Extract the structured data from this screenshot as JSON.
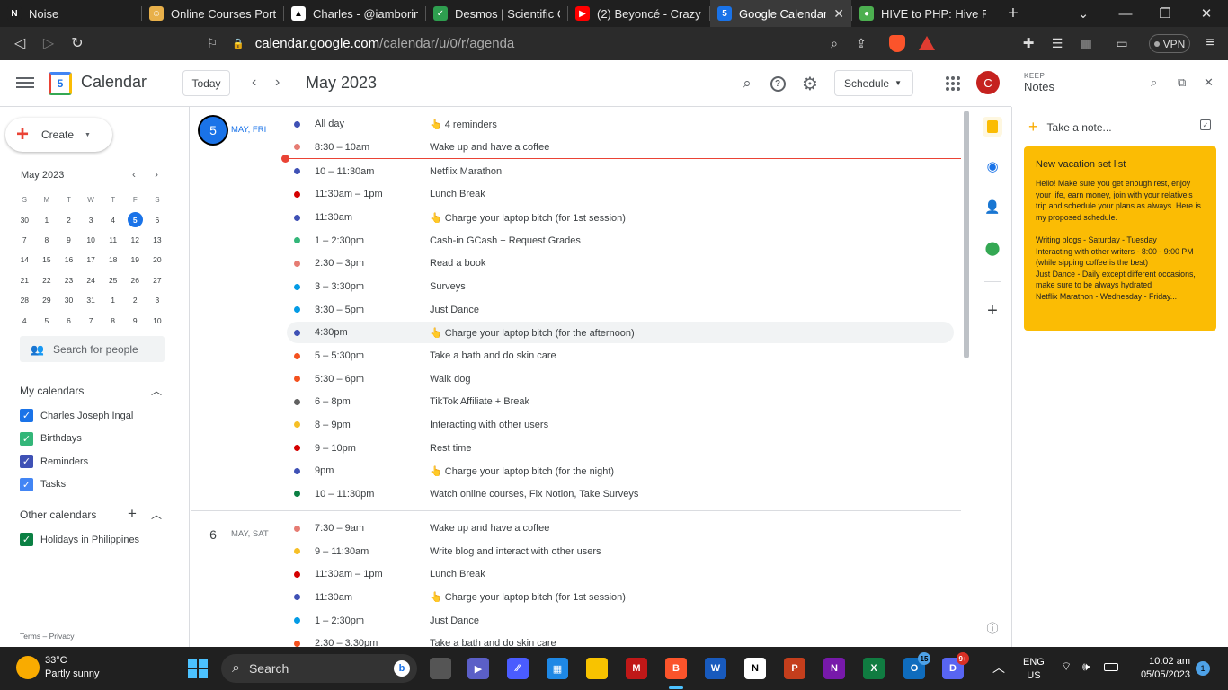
{
  "browser": {
    "tabs": [
      {
        "label": "Noise",
        "favicon_color": "#1f1f1f",
        "favicon_text": "N",
        "active": false
      },
      {
        "label": "Online Courses Portal",
        "favicon_color": "#e8b04a",
        "favicon_text": "☺",
        "active": false
      },
      {
        "label": "Charles - @iamboring",
        "favicon_color": "#ffffff",
        "favicon_text": "▲",
        "active": false
      },
      {
        "label": "Desmos | Scientific Cal",
        "favicon_color": "#2e9e4f",
        "favicon_text": "✓",
        "active": false
      },
      {
        "label": "(2) Beyoncé - Crazy",
        "favicon_color": "#ff0000",
        "favicon_text": "▶",
        "active": false
      },
      {
        "label": "Google Calendar -",
        "favicon_color": "#1a73e8",
        "favicon_text": "5",
        "active": true
      },
      {
        "label": "HIVE to PHP: Hive Pric",
        "favicon_color": "#4caf50",
        "favicon_text": "●",
        "active": false
      }
    ],
    "close_glyph": "✕",
    "new_tab_glyph": "+",
    "url_host": "calendar.google.com",
    "url_path": "/calendar/u/0/r/agenda",
    "vpn_label": "VPN"
  },
  "header": {
    "app_name": "Calendar",
    "logo_day": "5",
    "today_label": "Today",
    "month_title": "May 2023",
    "view_label": "Schedule",
    "avatar_letter": "C"
  },
  "sidebar": {
    "create_label": "Create",
    "mini_calendar": {
      "title": "May 2023",
      "weekdays": [
        "S",
        "M",
        "T",
        "W",
        "T",
        "F",
        "S"
      ],
      "days": [
        "30",
        "1",
        "2",
        "3",
        "4",
        "5",
        "6",
        "7",
        "8",
        "9",
        "10",
        "11",
        "12",
        "13",
        "14",
        "15",
        "16",
        "17",
        "18",
        "19",
        "20",
        "21",
        "22",
        "23",
        "24",
        "25",
        "26",
        "27",
        "28",
        "29",
        "30",
        "31",
        "1",
        "2",
        "3",
        "4",
        "5",
        "6",
        "7",
        "8",
        "9",
        "10"
      ],
      "selected_index": 5
    },
    "search_people_placeholder": "Search for people",
    "my_calendars_title": "My calendars",
    "my_calendars": [
      {
        "label": "Charles Joseph Ingal",
        "color": "#1a73e8"
      },
      {
        "label": "Birthdays",
        "color": "#33b679"
      },
      {
        "label": "Reminders",
        "color": "#3f51b5"
      },
      {
        "label": "Tasks",
        "color": "#4285f4"
      }
    ],
    "other_calendars_title": "Other calendars",
    "other_calendars": [
      {
        "label": "Holidays in Philippines",
        "color": "#0b8043"
      }
    ],
    "terms": "Terms – Privacy"
  },
  "agenda": {
    "days": [
      {
        "number": "5",
        "label": "MAY, FRI",
        "today": true,
        "events": [
          {
            "time": "All day",
            "title": "👆 4 reminders",
            "color": "#3f51b5"
          },
          {
            "time": "8:30 – 10am",
            "title": "Wake up and have a coffee",
            "color": "#e67c73"
          },
          {
            "time": "10 – 11:30am",
            "title": "Netflix Marathon",
            "color": "#3f51b5"
          },
          {
            "time": "11:30am – 1pm",
            "title": "Lunch Break",
            "color": "#d50000"
          },
          {
            "time": "11:30am",
            "title": "👆 Charge your laptop bitch (for 1st session)",
            "color": "#3f51b5"
          },
          {
            "time": "1 – 2:30pm",
            "title": "Cash-in GCash + Request Grades",
            "color": "#33b679"
          },
          {
            "time": "2:30 – 3pm",
            "title": "Read a book",
            "color": "#e67c73"
          },
          {
            "time": "3 – 3:30pm",
            "title": "Surveys",
            "color": "#039be5"
          },
          {
            "time": "3:30 – 5pm",
            "title": "Just Dance",
            "color": "#039be5"
          },
          {
            "time": "4:30pm",
            "title": "👆 Charge your laptop bitch (for the afternoon)",
            "color": "#3f51b5"
          },
          {
            "time": "5 – 5:30pm",
            "title": "Take a bath and do skin care",
            "color": "#f4511e"
          },
          {
            "time": "5:30 – 6pm",
            "title": "Walk dog",
            "color": "#f4511e"
          },
          {
            "time": "6 – 8pm",
            "title": "TikTok Affiliate + Break",
            "color": "#616161"
          },
          {
            "time": "8 – 9pm",
            "title": "Interacting with other users",
            "color": "#f6bf26"
          },
          {
            "time": "9 – 10pm",
            "title": "Rest time",
            "color": "#d50000"
          },
          {
            "time": "9pm",
            "title": "👆 Charge your laptop bitch (for the night)",
            "color": "#3f51b5"
          },
          {
            "time": "10 – 11:30pm",
            "title": "Watch online courses, Fix Notion, Take Surveys",
            "color": "#0b8043"
          }
        ]
      },
      {
        "number": "6",
        "label": "MAY, SAT",
        "today": false,
        "events": [
          {
            "time": "7:30 – 9am",
            "title": "Wake up and have a coffee",
            "color": "#e67c73"
          },
          {
            "time": "9 – 11:30am",
            "title": "Write blog and interact with other users",
            "color": "#f6bf26"
          },
          {
            "time": "11:30am – 1pm",
            "title": "Lunch Break",
            "color": "#d50000"
          },
          {
            "time": "11:30am",
            "title": "👆 Charge your laptop bitch (for 1st session)",
            "color": "#3f51b5"
          },
          {
            "time": "1 – 2:30pm",
            "title": "Just Dance",
            "color": "#039be5"
          },
          {
            "time": "2:30 – 3:30pm",
            "title": "Take a bath and do skin care",
            "color": "#f4511e"
          }
        ]
      }
    ]
  },
  "keep": {
    "small_label": "KEEP",
    "title": "Notes",
    "take_note_placeholder": "Take a note...",
    "note": {
      "title": "New vacation set list",
      "body": "Hello! Make sure you get enough rest, enjoy your life, earn money, join with your relative's trip and schedule your plans as always. Here is my proposed schedule.\n\nWriting blogs - Saturday - Tuesday\nInteracting with other writers - 8:00 - 9:00 PM (while sipping coffee is the best)\nJust Dance - Daily except different occasions, make sure to be always hydrated\nNetflix Marathon - Wednesday - Friday..."
    }
  },
  "taskbar": {
    "temperature": "33°C",
    "weather": "Partly sunny",
    "search_label": "Search",
    "language": "ENG",
    "region": "US",
    "time": "10:02 am",
    "date": "05/05/2023",
    "notification_count": "1",
    "outlook_badge": "15",
    "discord_badge": "9+"
  }
}
